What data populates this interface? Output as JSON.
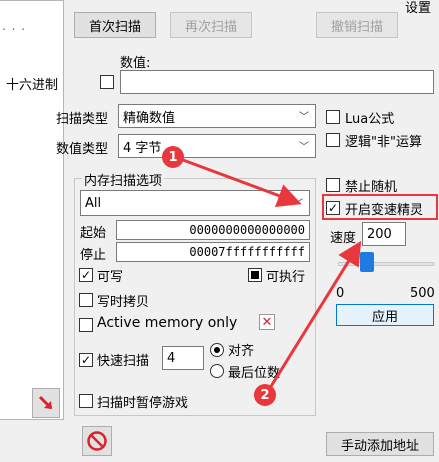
{
  "top_right_text": "设置",
  "list_pane": {
    "dots": ". . ."
  },
  "toolbar": {
    "first_scan": "首次扫描",
    "next_scan": "再次扫描",
    "undo_scan": "撤销扫描"
  },
  "value": {
    "label": "数值:",
    "hex_label": "十六进制",
    "input": ""
  },
  "scan_type": {
    "label": "扫描类型",
    "selected": "精确数值"
  },
  "value_type": {
    "label": "数值类型",
    "selected": "4 字节"
  },
  "right_options": {
    "lua": "Lua公式",
    "logic_not": "逻辑\"非\"运算",
    "no_random": "禁止随机",
    "speedhack": "开启变速精灵",
    "speedhack_checked": true
  },
  "speed": {
    "label": "速度",
    "value": "200",
    "min": "0",
    "max": "500",
    "apply": "应用",
    "fraction": 0.05
  },
  "memory": {
    "group_title": "内存扫描选项",
    "region": "All",
    "start_label": "起始",
    "start_value": "0000000000000000",
    "stop_label": "停止",
    "stop_value": "00007fffffffffff",
    "writable": "可写",
    "executable": "可执行",
    "copy_on_write": "写时拷贝",
    "active_memory": "Active memory only"
  },
  "fast_scan": {
    "label": "快速扫描",
    "value": "4",
    "align": "对齐",
    "last_digits": "最后位数"
  },
  "pause_game": "扫描时暂停游戏",
  "add_address": "手动添加地址",
  "annotations": {
    "one": "1",
    "two": "2"
  },
  "colors": {
    "annotation": "#e8383d",
    "slider": "#1e7be0"
  }
}
